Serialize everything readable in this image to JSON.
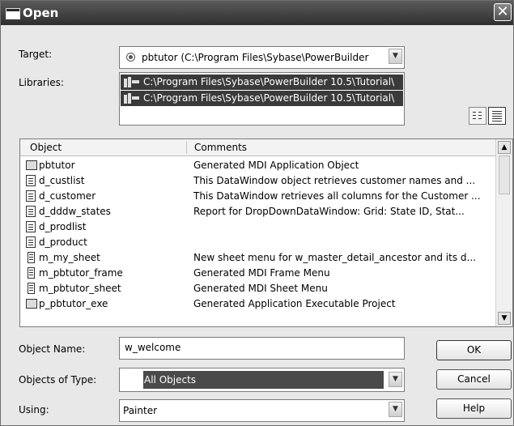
{
  "window": {
    "title": "Open"
  },
  "labels": {
    "target": "Target:",
    "libraries": "Libraries:",
    "object_name": "Object Name:",
    "objects_of_type": "Objects of Type:",
    "using": "Using:"
  },
  "target": {
    "value": "pbtutor (C:\\Program Files\\Sybase\\PowerBuilder"
  },
  "libraries": [
    "C:\\Program Files\\Sybase\\PowerBuilder 10.5\\Tutorial\\",
    "C:\\Program Files\\Sybase\\PowerBuilder 10.5\\Tutorial\\"
  ],
  "list": {
    "columns": [
      "Object",
      "Comments"
    ],
    "rows": [
      {
        "name": "pbtutor",
        "comment": "Generated MDI Application Object",
        "icon": "application-icon"
      },
      {
        "name": "d_custlist",
        "comment": "This DataWindow object retrieves customer names and ...",
        "icon": "datawindow-icon"
      },
      {
        "name": "d_customer",
        "comment": "This DataWindow retrieves all columns for the Customer ...",
        "icon": "datawindow-icon"
      },
      {
        "name": "d_dddw_states",
        "comment": "Report for DropDownDataWindow: Grid:  State ID, Stat...",
        "icon": "datawindow-icon"
      },
      {
        "name": "d_prodlist",
        "comment": "",
        "icon": "datawindow-icon"
      },
      {
        "name": "d_product",
        "comment": "",
        "icon": "datawindow-icon"
      },
      {
        "name": "m_my_sheet",
        "comment": "New sheet menu for w_master_detail_ancestor and its d...",
        "icon": "menu-icon"
      },
      {
        "name": "m_pbtutor_frame",
        "comment": "Generated MDI Frame Menu",
        "icon": "menu-icon"
      },
      {
        "name": "m_pbtutor_sheet",
        "comment": "Generated MDI Sheet Menu",
        "icon": "menu-icon"
      },
      {
        "name": "p_pbtutor_exe",
        "comment": "Generated Application Executable Project",
        "icon": "project-icon"
      }
    ]
  },
  "object_name": {
    "value": "w_welcome"
  },
  "objects_of_type": {
    "value": "All Objects"
  },
  "using": {
    "value": "Painter"
  },
  "buttons": {
    "ok": "OK",
    "cancel": "Cancel",
    "help": "Help"
  }
}
